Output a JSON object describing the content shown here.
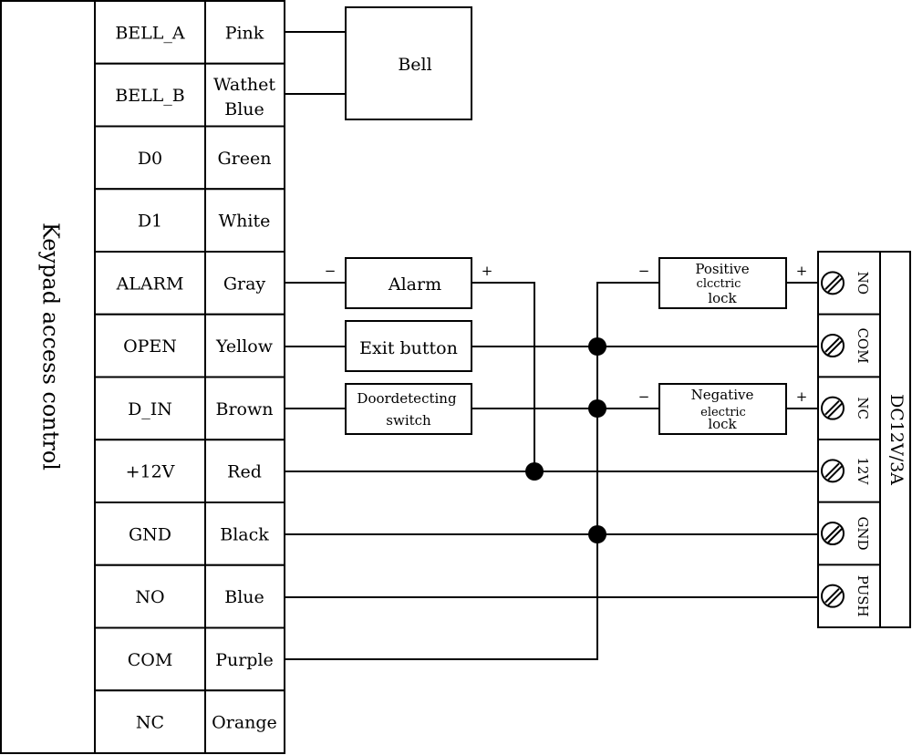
{
  "controller": {
    "title": "Keypad access control"
  },
  "wires": [
    {
      "terminal": "BELL_A",
      "color": "Pink"
    },
    {
      "terminal": "BELL_B",
      "color": "Wathet Blue"
    },
    {
      "terminal": "D0",
      "color": "Green"
    },
    {
      "terminal": "D1",
      "color": "White"
    },
    {
      "terminal": "ALARM",
      "color": "Gray"
    },
    {
      "terminal": "OPEN",
      "color": "Yellow"
    },
    {
      "terminal": "D_IN",
      "color": "Brown"
    },
    {
      "terminal": "+12V",
      "color": "Red"
    },
    {
      "terminal": "GND",
      "color": "Black"
    },
    {
      "terminal": "NO",
      "color": "Blue"
    },
    {
      "terminal": "COM",
      "color": "Purple"
    },
    {
      "terminal": "NC",
      "color": "Orange"
    }
  ],
  "devices": {
    "bell": "Bell",
    "alarm": "Alarm",
    "exit_button": "Exit button",
    "door_switch": [
      "Doordetecting",
      "switch"
    ],
    "positive_lock": [
      "Positive",
      "clcctric",
      "lock"
    ],
    "negative_lock": [
      "Negative",
      "electric",
      "lock"
    ],
    "minus": "−",
    "plus": "+"
  },
  "power_supply": {
    "title": "DC12V/3A",
    "terminals": [
      "NO",
      "COM",
      "NC",
      "12V",
      "GND",
      "PUSH"
    ]
  }
}
